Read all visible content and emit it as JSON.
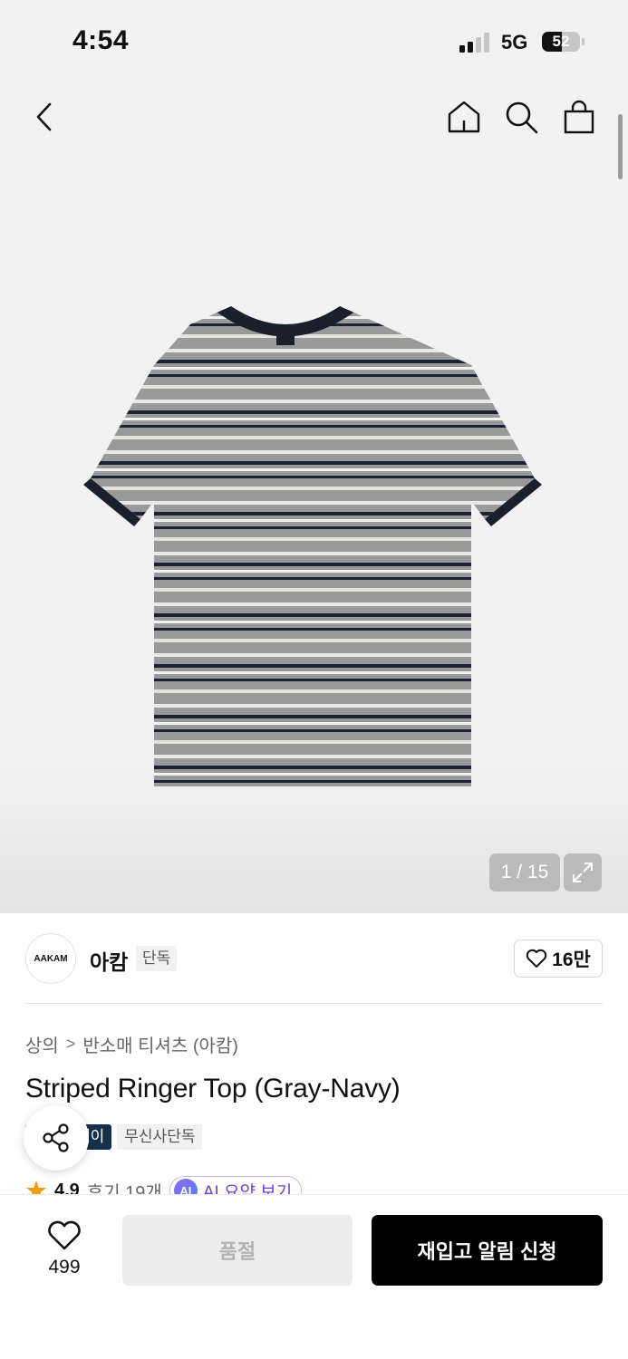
{
  "status_bar": {
    "time": "4:54",
    "network": "5G",
    "battery": "52",
    "battery_level": 0.52
  },
  "nav": {
    "back_icon": "chevron-left-icon",
    "home_icon": "home-icon",
    "search_icon": "search-icon",
    "cart_icon": "shopping-bag-icon"
  },
  "gallery": {
    "pager": "1 / 15",
    "expand_icon": "expand-icon"
  },
  "brand": {
    "logo_text": "AAKAM",
    "name": "아캄",
    "tag": "단독",
    "like_count": "16만"
  },
  "breadcrumb": {
    "category": "상의",
    "separator": ">",
    "subcategory": "반소매 티셔츠 (아캄)"
  },
  "product": {
    "title": "Striped Ringer Top (Gray-Navy)",
    "tags": [
      "페이",
      "무신사단독"
    ]
  },
  "rating": {
    "score": "4.9",
    "reviews": "후기 19개",
    "ai_badge": "AI",
    "ai_label": "AI 요약 보기"
  },
  "bottom_bar": {
    "wish_count": "499",
    "soldout_label": "품절",
    "restock_label": "재입고 알림 신청"
  },
  "colors": {
    "navy": "#16314b",
    "black": "#000000",
    "ai_purple": "#6b43d6",
    "star": "#f39c12"
  }
}
